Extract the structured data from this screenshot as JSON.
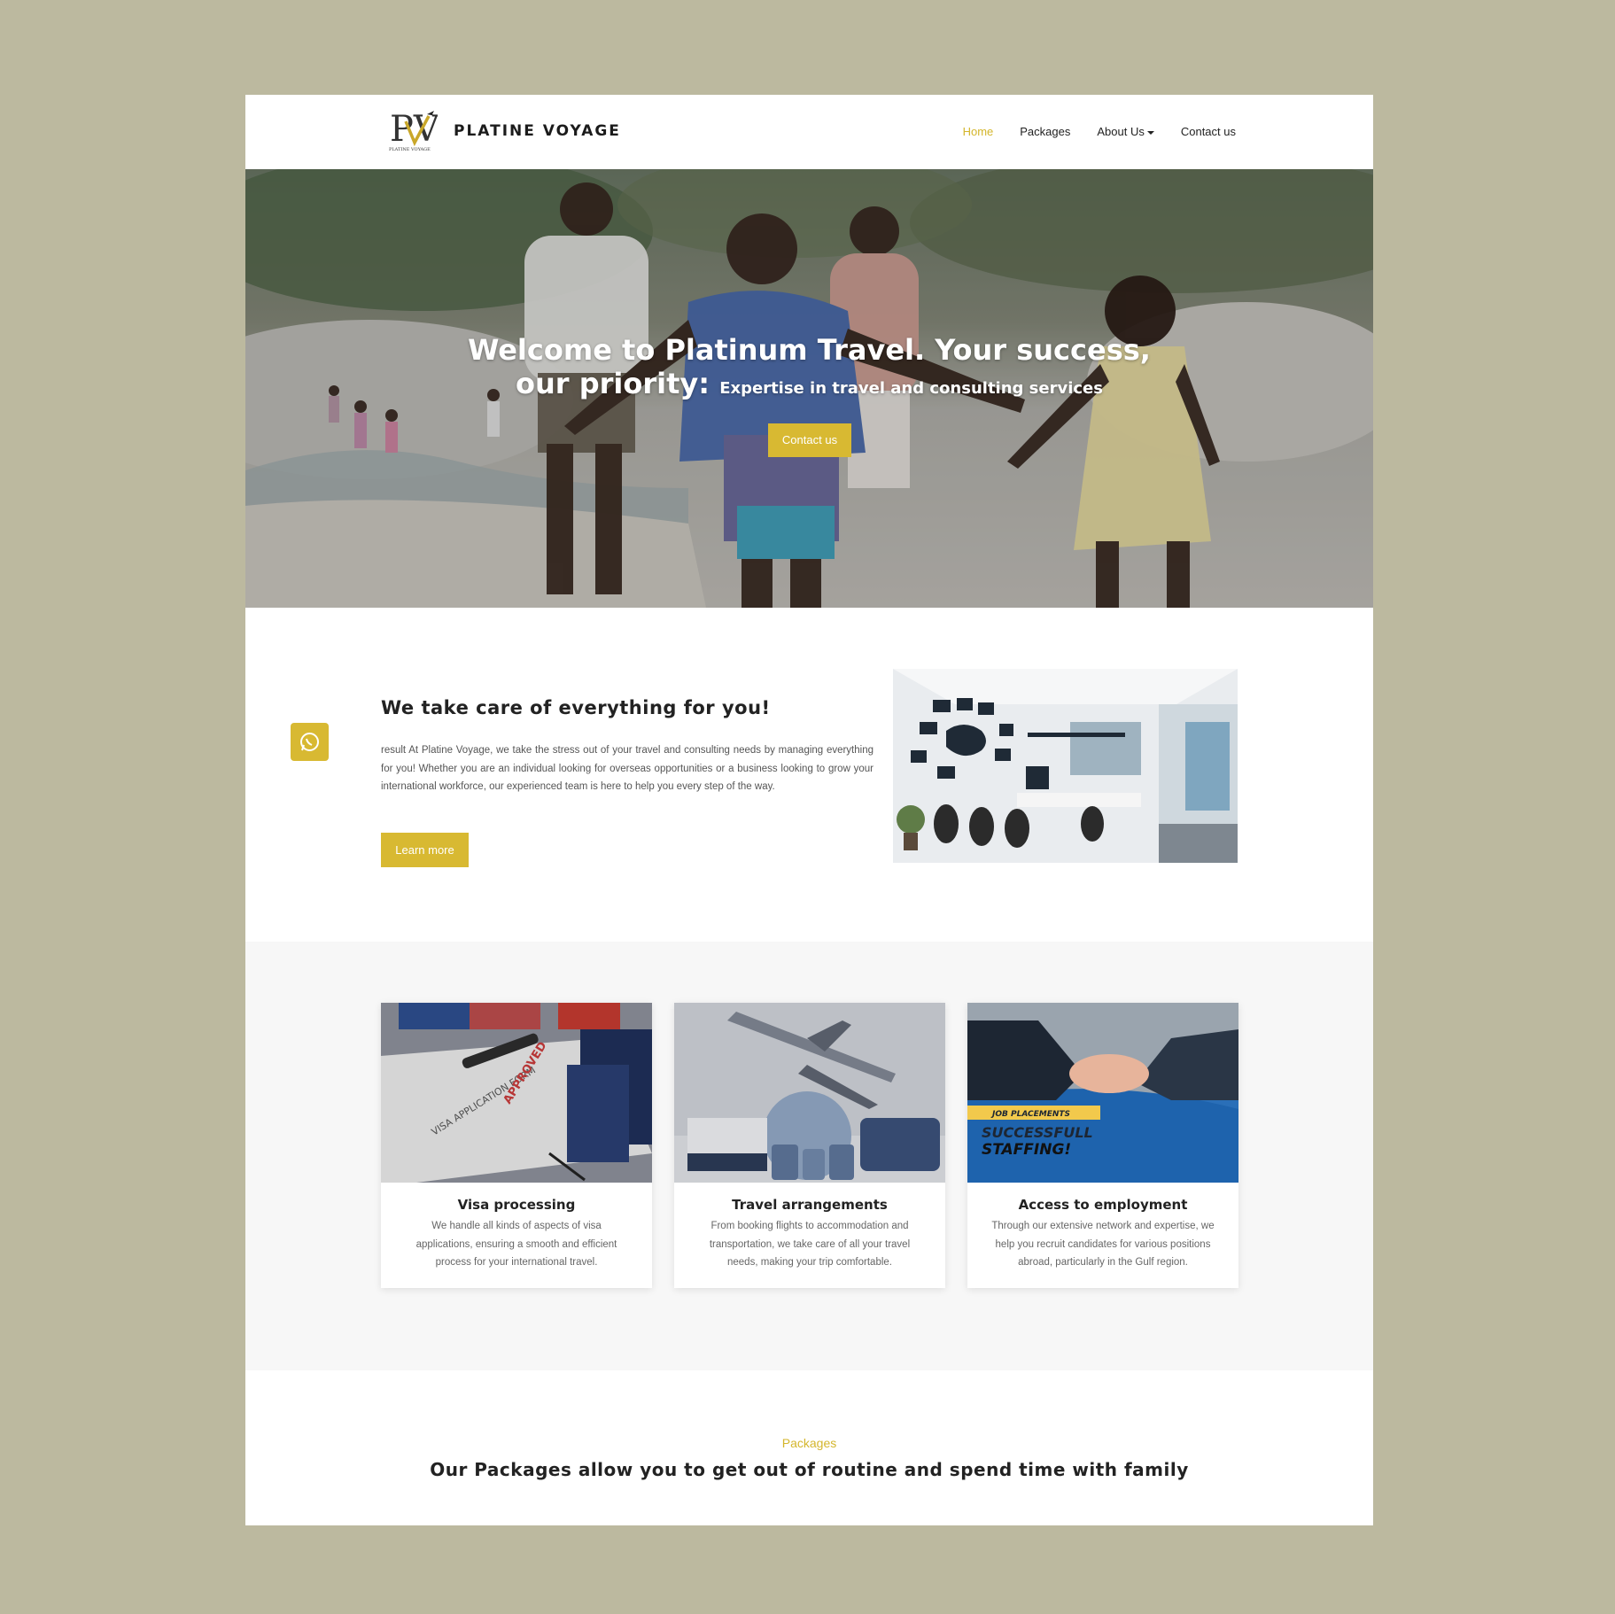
{
  "brand": {
    "name": "PLATINE VOYAGE",
    "logo_caption": "PLATINE VOYAGE",
    "logo_letters": "PV"
  },
  "nav": {
    "home": "Home",
    "packages": "Packages",
    "about": "About Us",
    "contact": "Contact us"
  },
  "hero": {
    "title_line1": "Welcome to Platinum Travel. Your success,",
    "title_line2": "our priority:",
    "subtitle": "Expertise in travel and consulting services",
    "button": "Contact us"
  },
  "about": {
    "title": "We take care of everything for you!",
    "text": "result At Platine Voyage, we take the stress out of your travel and consulting needs by managing everything for you! Whether you are an individual looking for overseas opportunities or a business looking to grow your international workforce, our experienced team is here to help you every step of the way.",
    "button": "Learn more"
  },
  "services": [
    {
      "title": "Visa processing",
      "desc": "We handle all kinds of aspects of visa applications, ensuring a smooth and efficient process for your international travel."
    },
    {
      "title": "Travel arrangements",
      "desc": "From booking flights to accommodation and transportation, we take care of all your travel needs, making your trip comfortable."
    },
    {
      "title": "Access to employment",
      "desc": "Through our extensive network and expertise, we help you recruit candidates for various positions abroad, particularly in the Gulf region."
    }
  ],
  "service_images": {
    "visa_label": "VISA APPLICATION FORM",
    "visa_stamp": "APPROVED",
    "job_tag": "JOB PLACEMENTS",
    "job_line1": "SUCCESSFULL",
    "job_line2": "STAFFING!"
  },
  "packages": {
    "kicker": "Packages",
    "title": "Our Packages allow you to get out of routine and spend time with family"
  },
  "colors": {
    "accent": "#d8b932",
    "page_bg": "#bcb99f",
    "section_bg": "#f7f7f7"
  },
  "icons": {
    "whatsapp": "whatsapp-icon",
    "caret": "chevron-down-icon"
  }
}
